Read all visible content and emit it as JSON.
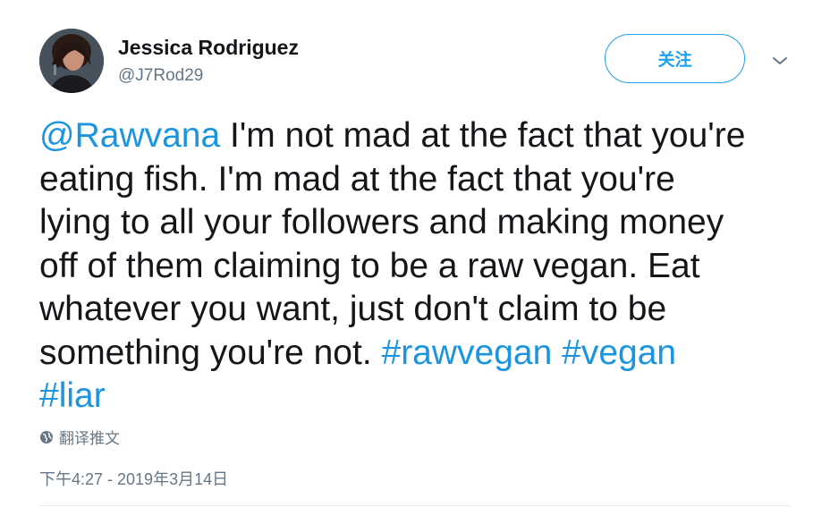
{
  "user": {
    "display_name": "Jessica Rodriguez",
    "handle": "@J7Rod29",
    "avatar_icon": "avatar"
  },
  "follow_button": {
    "label": "关注"
  },
  "menu": {
    "icon": "chevron-down-icon"
  },
  "tweet": {
    "mention": "@Rawvana",
    "line1": " I'm not mad at the fact that you're",
    "line2": "eating fish. I'm mad at the fact that you're",
    "line3": "lying to all your followers and making money",
    "line4": "off of them claiming to be a raw vegan. Eat",
    "line5": "whatever you want, just don't claim to be",
    "line6": "something you're not. ",
    "hashtags": [
      "#rawvegan",
      "#vegan",
      "#liar"
    ]
  },
  "translate": {
    "label": "翻译推文",
    "icon": "globe-icon"
  },
  "timestamp": "下午4:27 - 2019年3月14日",
  "colors": {
    "link": "#1b95e0",
    "button_accent": "#1da1f2",
    "text_primary": "#14171a",
    "text_secondary": "#657786",
    "divider": "#e6ecf0"
  }
}
